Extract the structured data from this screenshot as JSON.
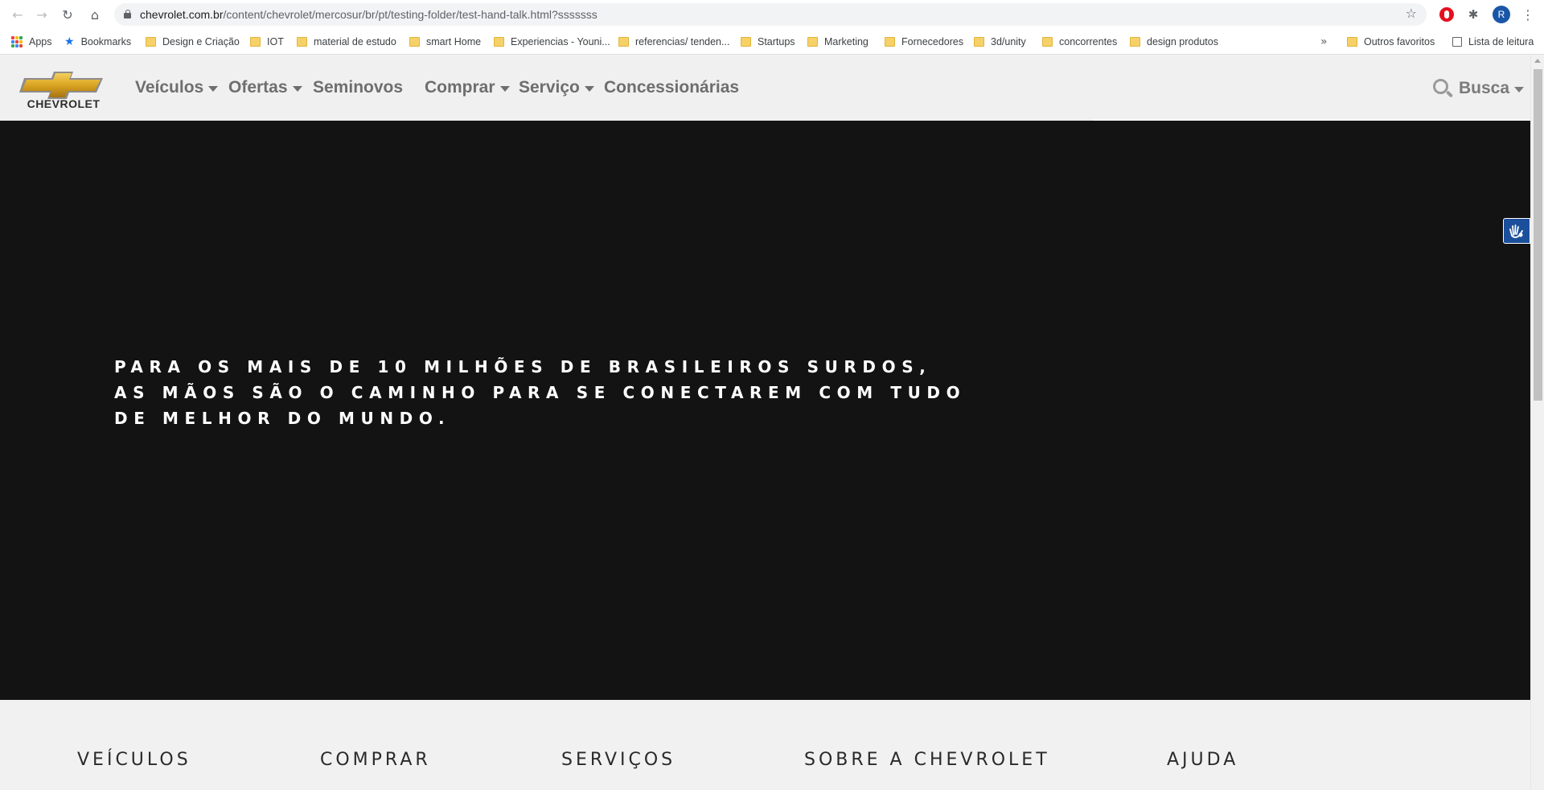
{
  "browser": {
    "url_host": "chevrolet.com.br",
    "url_path": "/content/chevrolet/mercosur/br/pt/testing-folder/test-hand-talk.html?sssssss",
    "profile_initial": "R"
  },
  "bookmarks": {
    "items": [
      {
        "label": "Apps",
        "icon": "apps-grid-icon"
      },
      {
        "label": "Bookmarks",
        "icon": "star-icon"
      },
      {
        "label": "Design e Criação",
        "icon": "folder-icon"
      },
      {
        "label": "IOT",
        "icon": "folder-icon"
      },
      {
        "label": "material de estudo",
        "icon": "folder-icon"
      },
      {
        "label": "smart Home",
        "icon": "folder-icon"
      },
      {
        "label": "Experiencias - Youni...",
        "icon": "folder-icon"
      },
      {
        "label": "referencias/ tenden...",
        "icon": "folder-icon"
      },
      {
        "label": "Startups",
        "icon": "folder-icon"
      },
      {
        "label": "Marketing",
        "icon": "folder-icon"
      },
      {
        "label": "Fornecedores",
        "icon": "folder-icon"
      },
      {
        "label": "3d/unity",
        "icon": "folder-icon"
      },
      {
        "label": "concorrentes",
        "icon": "folder-icon"
      },
      {
        "label": "design produtos",
        "icon": "folder-icon"
      }
    ],
    "more": "»",
    "other": "Outros favoritos",
    "reading_list": "Lista de leitura"
  },
  "site": {
    "logo_text": "CHEVROLET",
    "nav": {
      "veiculos": "Veículos",
      "ofertas": "Ofertas",
      "seminovos": "Seminovos",
      "comprar": "Comprar",
      "servico": "Serviço",
      "concessionarias": "Concessionárias"
    },
    "search_label": "Busca",
    "brand_gold": "#d9a421"
  },
  "hero": {
    "lines": [
      "PARA OS MAIS DE 10 MILHÕES DE BRASILEIROS SURDOS,",
      "AS MÃOS SÃO O CAMINHO PARA SE CONECTAREM COM TUDO",
      "DE MELHOR DO MUNDO."
    ]
  },
  "footer": {
    "veiculos": "VEÍCULOS",
    "comprar": "COMPRAR",
    "servicos": "SERVIÇOS",
    "sobre": "SOBRE A CHEVROLET",
    "ajuda": "AJUDA"
  }
}
